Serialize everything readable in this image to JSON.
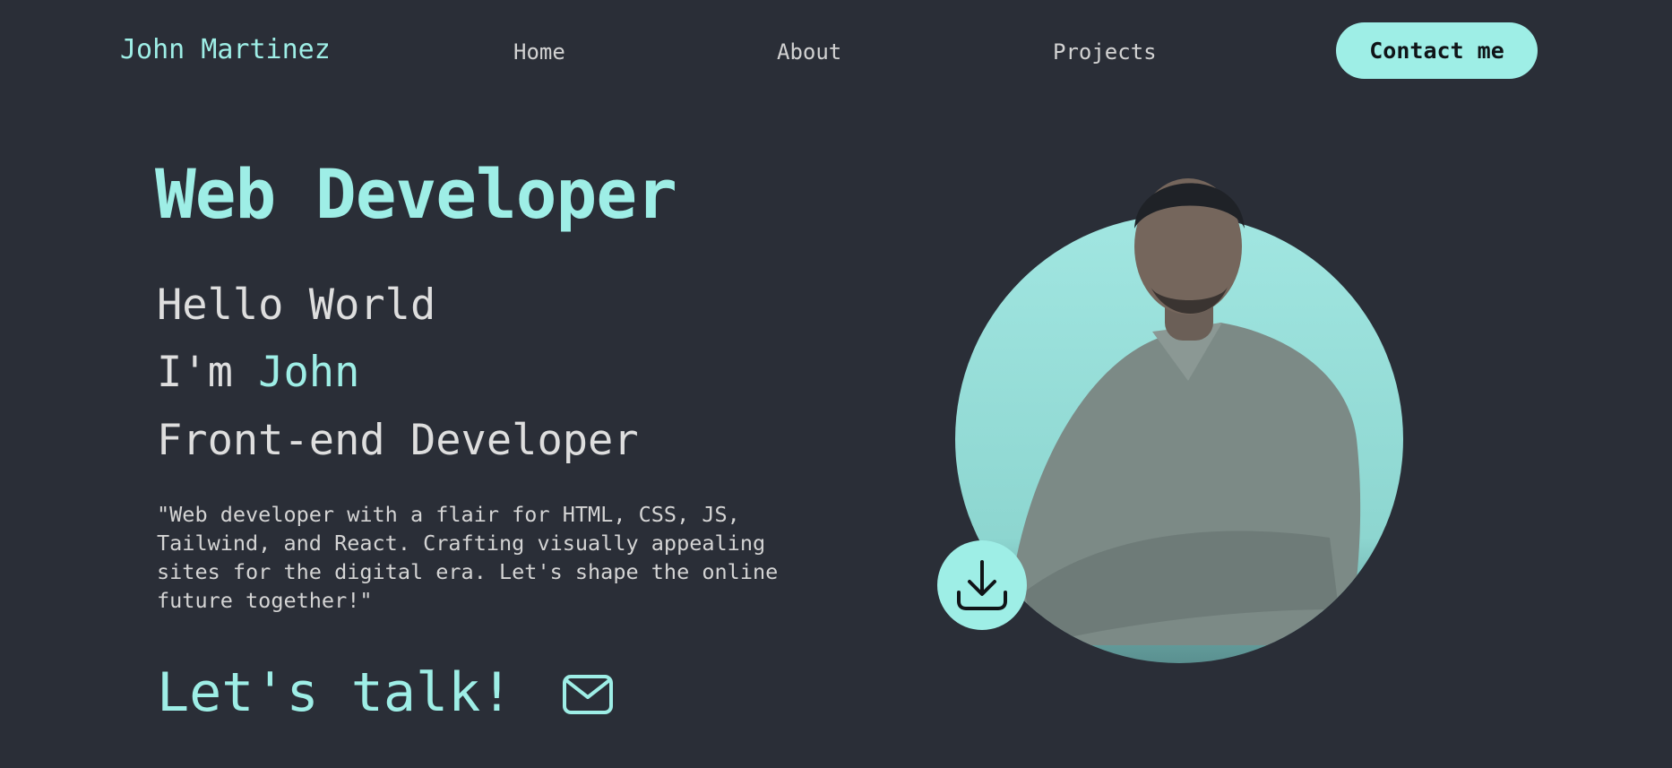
{
  "nav": {
    "brand": "John Martinez",
    "links": [
      {
        "label": "Home"
      },
      {
        "label": "About"
      },
      {
        "label": "Projects"
      }
    ],
    "contact_label": "Contact me"
  },
  "hero": {
    "title": "Web Developer",
    "greeting": "Hello World",
    "intro_prefix": "I'm ",
    "intro_name": "John",
    "role": "Front-end Developer",
    "bio": "\"Web developer with a flair for HTML, CSS, JS, Tailwind, and React. Crafting visually appealing sites for the digital era. Let's shape the online future together!\"",
    "cta": "Let's talk!"
  },
  "icons": {
    "mail": "mail-icon",
    "download": "download-icon"
  },
  "colors": {
    "background": "#2a2e37",
    "accent": "#9eeee6",
    "text": "#d7d7d7"
  }
}
